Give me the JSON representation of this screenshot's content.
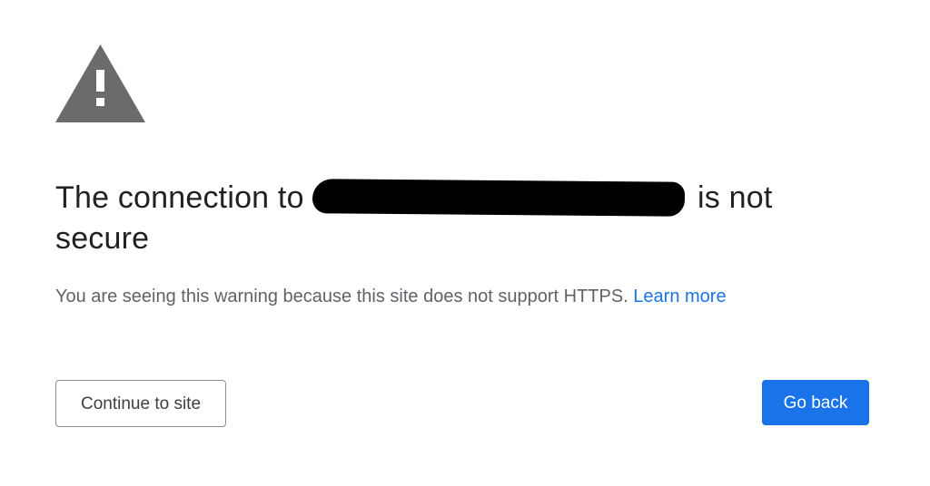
{
  "icon": {
    "name": "warning-triangle-icon",
    "color": "#6b6b6b"
  },
  "heading": {
    "prefix": "The connection to",
    "suffix": "is not secure"
  },
  "message": {
    "text": "You are seeing this warning because this site does not support HTTPS.",
    "link": "Learn more"
  },
  "actions": {
    "continue_label": "Continue to site",
    "go_back_label": "Go back"
  },
  "colors": {
    "primary": "#1a73e8",
    "text": "#202124",
    "secondary_text": "#5f6368"
  }
}
